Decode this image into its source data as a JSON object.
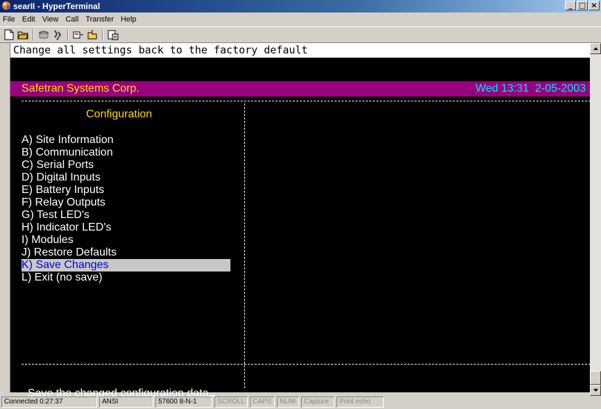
{
  "window": {
    "title": "searII - HyperTerminal"
  },
  "window_controls": {
    "minimize": "_",
    "maximize": "□",
    "close": "×"
  },
  "menubar": [
    {
      "label": "File"
    },
    {
      "label": "Edit"
    },
    {
      "label": "View"
    },
    {
      "label": "Call"
    },
    {
      "label": "Transfer"
    },
    {
      "label": "Help"
    }
  ],
  "toolbar": [
    {
      "icon": "new-document-icon"
    },
    {
      "icon": "open-folder-icon"
    },
    {
      "icon": "call-phone-icon"
    },
    {
      "icon": "disconnect-icon"
    },
    {
      "icon": "send-file-icon"
    },
    {
      "icon": "receive-file-icon"
    },
    {
      "icon": "properties-icon"
    }
  ],
  "terminal": {
    "banner": "Change all settings back to the factory default",
    "header_left": "Safetran Systems Corp.",
    "header_right": "Wed 13:31  2-05-2003",
    "config_title": "Configuration",
    "menu": [
      {
        "text": "A) Site Information",
        "selected": false
      },
      {
        "text": "B) Communication",
        "selected": false
      },
      {
        "text": "C) Serial Ports",
        "selected": false
      },
      {
        "text": "D) Digital Inputs",
        "selected": false
      },
      {
        "text": "E) Battery Inputs",
        "selected": false
      },
      {
        "text": "F) Relay Outputs",
        "selected": false
      },
      {
        "text": "G) Test LED's",
        "selected": false
      },
      {
        "text": "H) Indicator LED's",
        "selected": false
      },
      {
        "text": "I) Modules",
        "selected": false
      },
      {
        "text": "J) Restore Defaults",
        "selected": false
      },
      {
        "text": "K) Save Changes",
        "selected": true
      },
      {
        "text": "L) Exit (no save)",
        "selected": false
      }
    ],
    "status_line": "Save the changed configuration data",
    "colors": {
      "header_bg": "#990080",
      "header_left": "#ffd700",
      "header_right": "#00e5ff",
      "title": "#ffd700",
      "selection_bg": "#c8c8c8",
      "selection_fg": "#0000ee"
    }
  },
  "statusbar": {
    "connected": "Connected 0:27:37",
    "emulation": "ANSI",
    "port_settings": "57600 8-N-1",
    "scroll": "SCROLL",
    "caps": "CAPS",
    "num": "NUM",
    "capture": "Capture",
    "print_echo": "Print echo"
  }
}
